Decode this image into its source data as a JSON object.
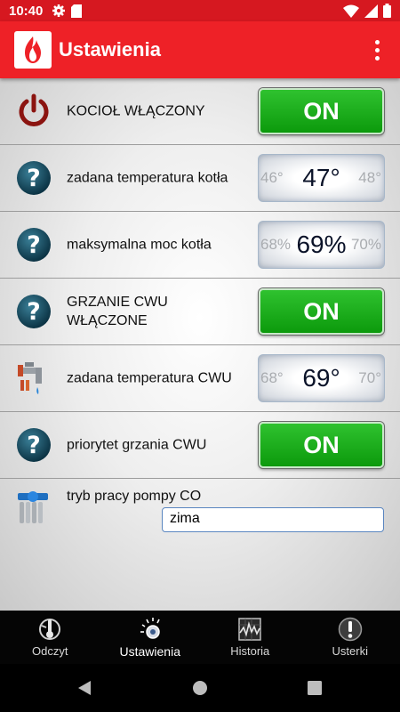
{
  "status_bar": {
    "time": "10:40"
  },
  "app_bar": {
    "title": "Ustawienia"
  },
  "settings": [
    {
      "label": "KOCIOŁ WŁĄCZONY",
      "icon": "power-icon",
      "control": "toggle",
      "value": "ON"
    },
    {
      "label": "zadana temperatura kotła",
      "icon": "help-icon",
      "control": "picker",
      "prev": "46°",
      "value": "47°",
      "next": "48°"
    },
    {
      "label": "maksymalna moc kotła",
      "icon": "help-icon",
      "control": "picker",
      "prev": "68%",
      "value": "69%",
      "next": "70%"
    },
    {
      "label": "GRZANIE CWU WŁĄCZONE",
      "icon": "help-icon",
      "control": "toggle",
      "value": "ON"
    },
    {
      "label": "zadana temperatura CWU",
      "icon": "hot-water-tap-icon",
      "control": "picker",
      "prev": "68°",
      "value": "69°",
      "next": "70°"
    },
    {
      "label": "priorytet grzania CWU",
      "icon": "help-icon",
      "control": "toggle",
      "value": "ON"
    }
  ],
  "pump_mode": {
    "label": "tryb pracy pompy CO",
    "icon": "radiator-pump-icon",
    "value": "zima"
  },
  "bottom_nav": [
    {
      "label": "Odczyt",
      "icon": "thermometer-icon",
      "active": false
    },
    {
      "label": "Ustawienia",
      "icon": "dial-icon",
      "active": true
    },
    {
      "label": "Historia",
      "icon": "chart-icon",
      "active": false
    },
    {
      "label": "Usterki",
      "icon": "warning-icon",
      "active": false
    }
  ],
  "colors": {
    "status_bar": "#d61820",
    "app_bar": "#ee2127",
    "toggle_on": "#17a617",
    "nav_bg": "#050505"
  }
}
